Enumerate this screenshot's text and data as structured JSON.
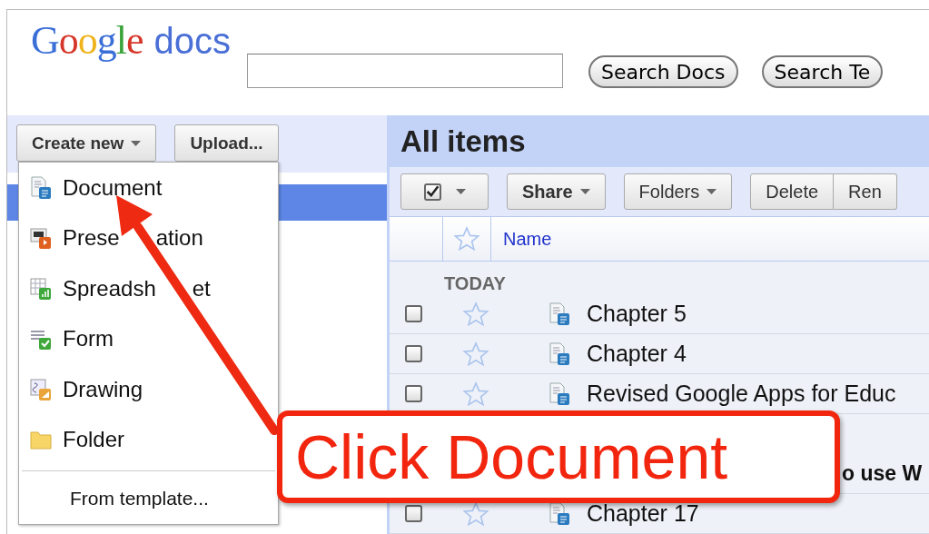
{
  "header": {
    "logo": {
      "brand": "Google",
      "product": "docs"
    },
    "buttons": [
      "Search Docs",
      "Search Te"
    ]
  },
  "sidebar": {
    "create_button": "Create new",
    "upload_button": "Upload..."
  },
  "create_menu": {
    "items": [
      {
        "kind": "document",
        "label": "Document"
      },
      {
        "kind": "presentation",
        "label_parts": [
          "Prese",
          "ation"
        ]
      },
      {
        "kind": "spreadsheet",
        "label_parts": [
          "Spreadsh",
          "et"
        ]
      },
      {
        "kind": "form",
        "label": "Form"
      },
      {
        "kind": "drawing",
        "label": "Drawing"
      },
      {
        "kind": "folder",
        "label": "Folder"
      }
    ],
    "template_item": "From template..."
  },
  "main": {
    "title": "All items",
    "toolbar": {
      "select_all_checked": true,
      "buttons": [
        {
          "label": "Share",
          "dropdown": true,
          "bold": true
        },
        {
          "label": "Folders",
          "dropdown": true,
          "bold": false
        },
        {
          "label": "Delete",
          "dropdown": false,
          "bold": false
        },
        {
          "label": "Ren",
          "dropdown": false,
          "bold": false
        }
      ]
    },
    "columns": {
      "starred": false,
      "name": "Name"
    },
    "groups": [
      {
        "label": "TODAY",
        "rows": [
          {
            "kind": "document",
            "name": "Chapter 5",
            "checked": false,
            "starred": false
          },
          {
            "kind": "document",
            "name": "Chapter 4",
            "checked": false,
            "starred": false
          },
          {
            "kind": "document",
            "name": "Revised Google Apps for Educ",
            "checked": false,
            "starred": false
          },
          {
            "kind": "covered",
            "name": "o use W"
          },
          {
            "kind": "document",
            "name": "Chapter 17",
            "checked": false,
            "starred": false
          }
        ]
      }
    ]
  },
  "callout": {
    "text": "Click Document"
  }
}
